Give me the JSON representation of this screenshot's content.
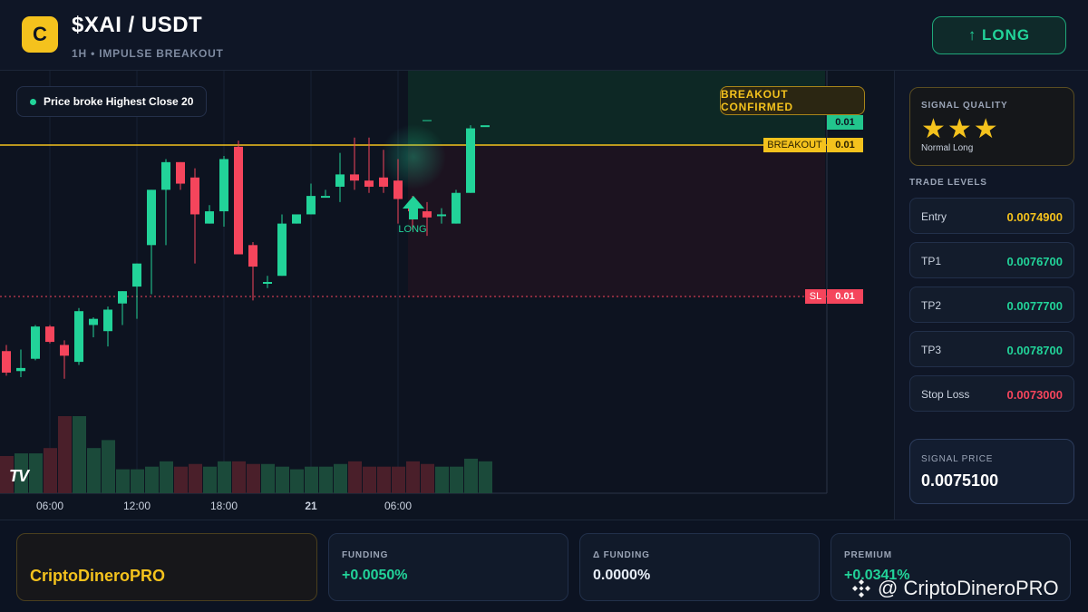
{
  "header": {
    "logo_letter": "C",
    "pair": "$XAI / USDT",
    "subtitle": "1H • IMPULSE BREAKOUT",
    "direction_button": "↑ LONG"
  },
  "chart": {
    "condition_text": "Price broke Highest Close 20",
    "confirmed_badge": "BREAKOUT CONFIRMED",
    "long_marker_label": "LONG",
    "tv_logo_text": "TV",
    "price_tags": {
      "target": "0.01",
      "breakout_label": "BREAKOUT",
      "breakout_value": "0.01",
      "sl_label": "SL",
      "sl_value": "0.01"
    },
    "time_labels": [
      "06:00",
      "12:00",
      "18:00",
      "21",
      "06:00"
    ]
  },
  "chart_data": {
    "type": "candlestick",
    "candles": [
      {
        "o": 7.535,
        "h": 7.555,
        "l": 7.455,
        "c": 7.465
      },
      {
        "o": 7.47,
        "h": 7.54,
        "l": 7.45,
        "c": 7.48
      },
      {
        "o": 7.51,
        "h": 7.62,
        "l": 7.505,
        "c": 7.615
      },
      {
        "o": 7.615,
        "h": 7.62,
        "l": 7.56,
        "c": 7.565
      },
      {
        "o": 7.555,
        "h": 7.57,
        "l": 7.445,
        "c": 7.52
      },
      {
        "o": 7.5,
        "h": 7.675,
        "l": 7.49,
        "c": 7.665
      },
      {
        "o": 7.62,
        "h": 7.645,
        "l": 7.58,
        "c": 7.64
      },
      {
        "o": 7.6,
        "h": 7.68,
        "l": 7.55,
        "c": 7.67
      },
      {
        "o": 7.69,
        "h": 7.73,
        "l": 7.62,
        "c": 7.73
      },
      {
        "o": 7.745,
        "h": 7.79,
        "l": 7.64,
        "c": 7.82
      },
      {
        "o": 7.88,
        "h": 7.98,
        "l": 7.72,
        "c": 8.06
      },
      {
        "o": 8.06,
        "h": 8.16,
        "l": 7.88,
        "c": 8.15
      },
      {
        "o": 8.15,
        "h": 8.13,
        "l": 8.06,
        "c": 8.08
      },
      {
        "o": 8.1,
        "h": 8.13,
        "l": 7.82,
        "c": 7.98
      },
      {
        "o": 7.95,
        "h": 8.01,
        "l": 7.96,
        "c": 7.99
      },
      {
        "o": 7.99,
        "h": 8.17,
        "l": 7.94,
        "c": 8.16
      },
      {
        "o": 8.2,
        "h": 8.22,
        "l": 7.91,
        "c": 7.85
      },
      {
        "o": 7.88,
        "h": 7.89,
        "l": 7.7,
        "c": 7.81
      },
      {
        "o": 7.76,
        "h": 7.78,
        "l": 7.74,
        "c": 7.76
      },
      {
        "o": 7.78,
        "h": 7.98,
        "l": 7.79,
        "c": 7.95
      },
      {
        "o": 7.95,
        "h": 7.98,
        "l": 7.95,
        "c": 7.98
      },
      {
        "o": 7.98,
        "h": 8.08,
        "l": 7.98,
        "c": 8.04
      },
      {
        "o": 8.04,
        "h": 8.06,
        "l": 8.04,
        "c": 8.04
      },
      {
        "o": 8.07,
        "h": 8.18,
        "l": 8.02,
        "c": 8.11
      },
      {
        "o": 8.11,
        "h": 8.23,
        "l": 8.06,
        "c": 8.09
      },
      {
        "o": 8.09,
        "h": 8.23,
        "l": 8.05,
        "c": 8.07
      },
      {
        "o": 8.1,
        "h": 8.19,
        "l": 8.05,
        "c": 8.07
      },
      {
        "o": 8.09,
        "h": 8.16,
        "l": 7.95,
        "c": 8.03
      },
      {
        "o": 8.02,
        "h": 8.04,
        "l": 7.93,
        "c": 7.99
      },
      {
        "o": 7.99,
        "h": 8.02,
        "l": 7.91,
        "c": 7.97
      },
      {
        "o": 7.98,
        "h": 8.0,
        "l": 7.95,
        "c": 7.98
      },
      {
        "o": 7.95,
        "h": 8.06,
        "l": 7.95,
        "c": 8.05
      },
      {
        "o": 8.05,
        "h": 8.27,
        "l": 8.05,
        "c": 8.26
      },
      {
        "o": 8.27,
        "h": 8.27,
        "l": 8.27,
        "c": 8.27
      }
    ],
    "volume": [
      28,
      30,
      30,
      34,
      58,
      58,
      34,
      40,
      18,
      18,
      20,
      24,
      20,
      22,
      20,
      24,
      24,
      22,
      22,
      20,
      18,
      20,
      20,
      22,
      24,
      20,
      20,
      20,
      24,
      22,
      20,
      20,
      26,
      24
    ]
  },
  "side": {
    "quality_label": "SIGNAL QUALITY",
    "stars": "★★★",
    "quality_note": "Normal Long",
    "levels_title": "TRADE LEVELS",
    "levels": [
      {
        "name": "Entry",
        "value": "0.0074900",
        "color": "#f4c21d"
      },
      {
        "name": "TP1",
        "value": "0.0076700",
        "color": "#22d399"
      },
      {
        "name": "TP2",
        "value": "0.0077700",
        "color": "#22d399"
      },
      {
        "name": "TP3",
        "value": "0.0078700",
        "color": "#22d399"
      },
      {
        "name": "Stop Loss",
        "value": "0.0073000",
        "color": "#f5455c"
      }
    ],
    "signal_price_label": "SIGNAL PRICE",
    "signal_price": "0.0075100"
  },
  "footer": {
    "brand": "CriptoDineroPRO",
    "cards": [
      {
        "label": "FUNDING",
        "value": "+0.0050%",
        "color": "#22d399"
      },
      {
        "label": "Δ FUNDING",
        "value": "0.0000%",
        "color": "#e6edf6"
      },
      {
        "label": "PREMIUM",
        "value": "+0.0341%",
        "color": "#22d399"
      }
    ],
    "watermark": "@ CriptoDineroPRO"
  },
  "colors": {
    "up": "#22d399",
    "down": "#f5455c",
    "accent": "#f4c21d"
  }
}
